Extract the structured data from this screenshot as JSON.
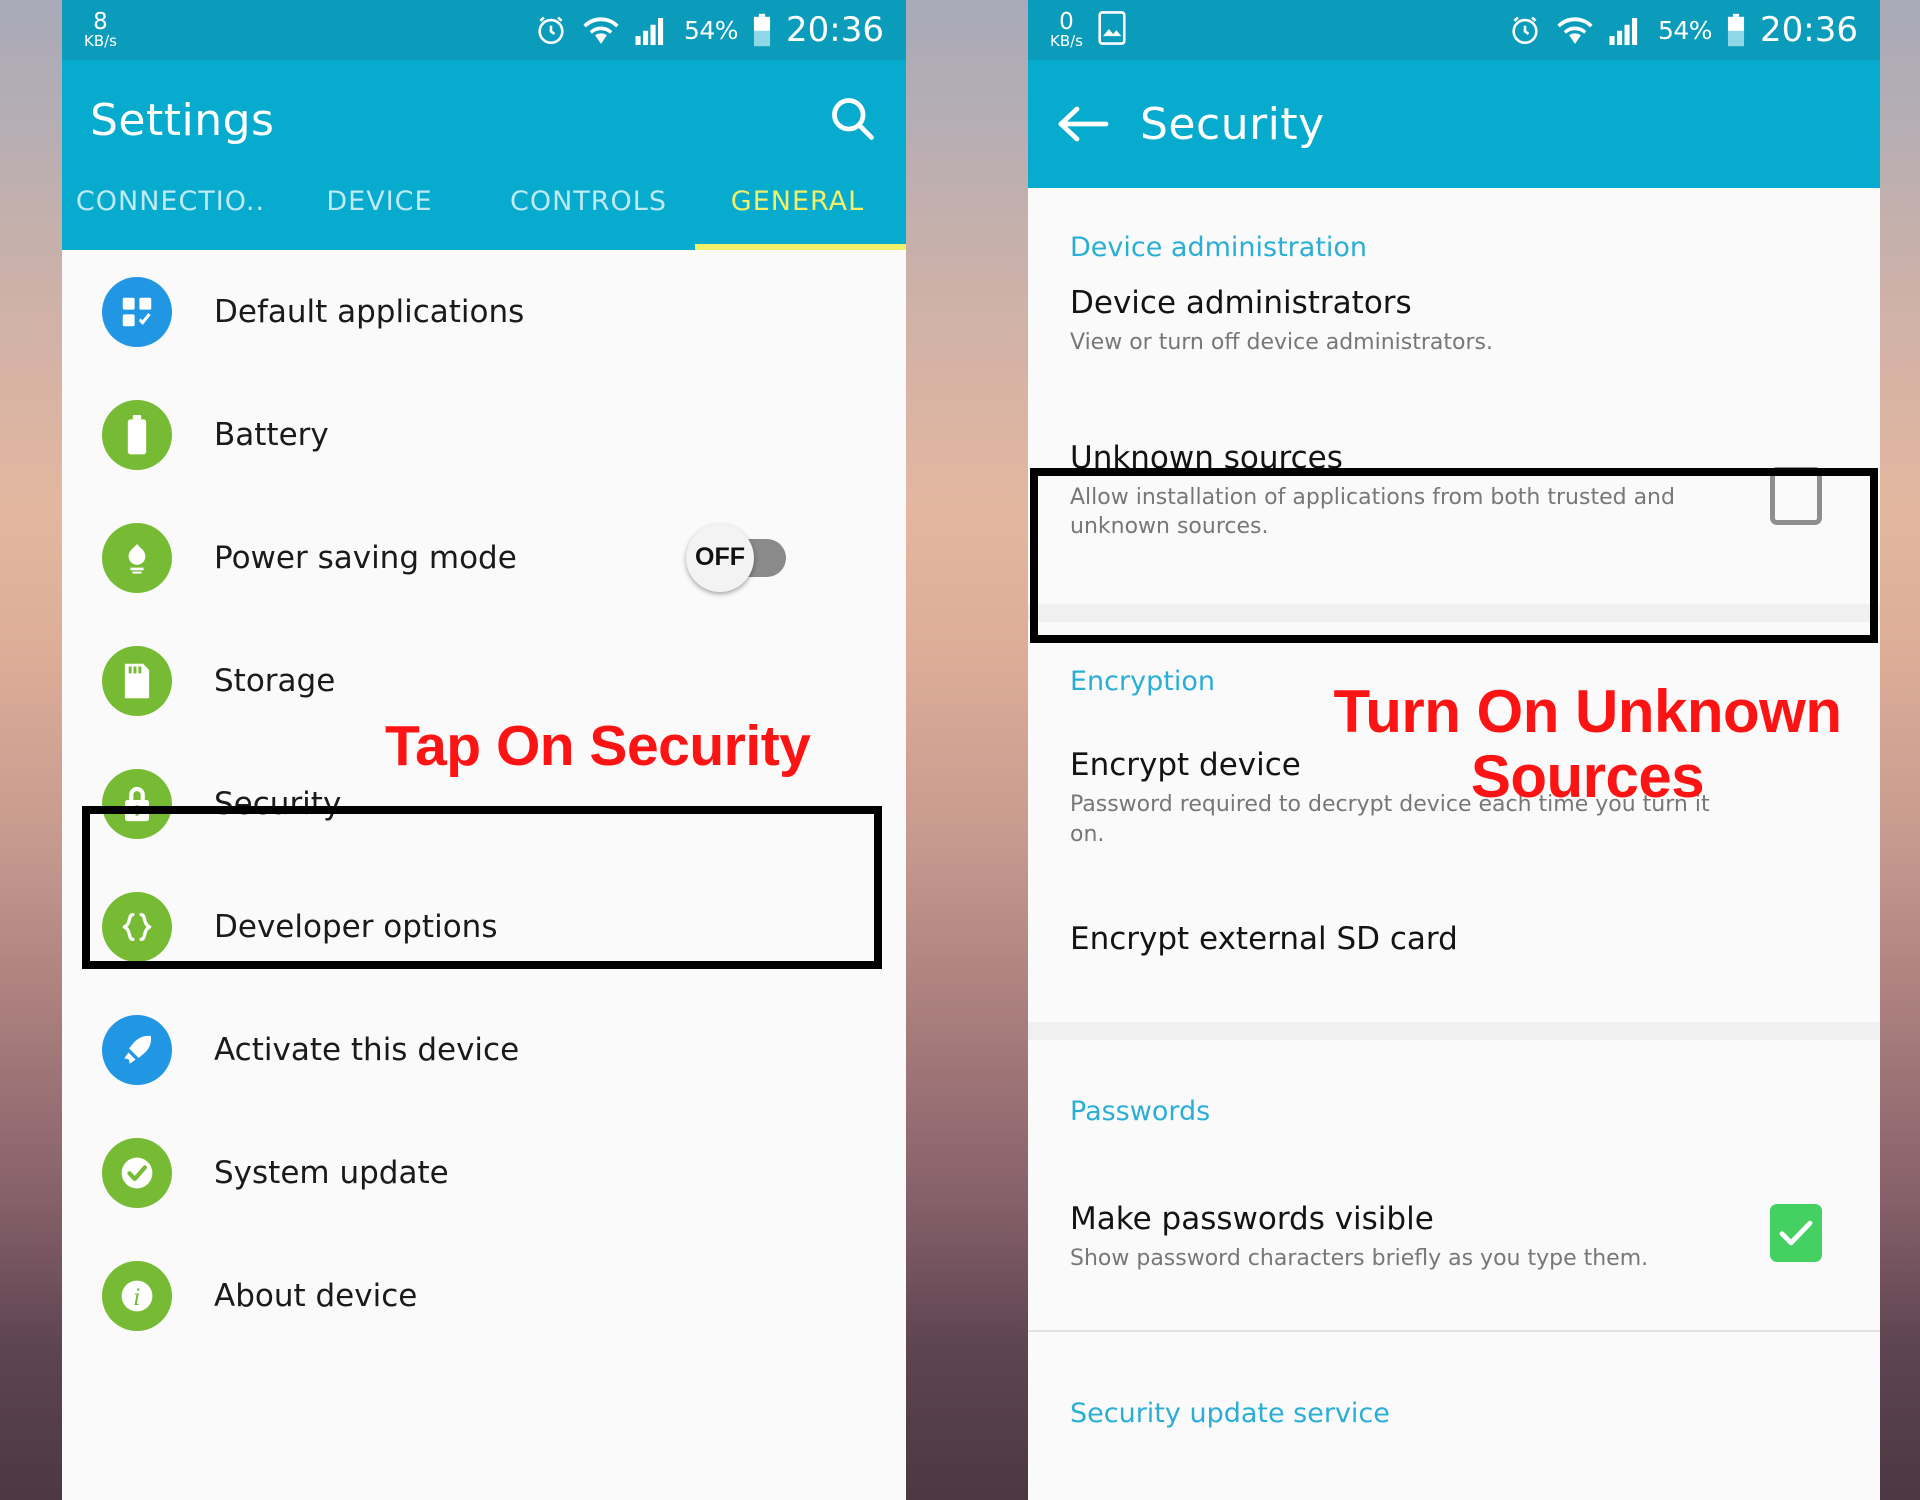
{
  "left_phone": {
    "status_bar": {
      "net_speed_value": "8",
      "net_speed_unit": "KB/s",
      "battery_percent": "54%",
      "clock": "20:36",
      "icons": [
        "alarm-icon",
        "wifi-icon",
        "signal-icon",
        "battery-icon"
      ]
    },
    "app_bar": {
      "title": "Settings",
      "search_icon": "search-icon"
    },
    "tabs": [
      {
        "label": "CONNECTIO..",
        "active": false
      },
      {
        "label": "DEVICE",
        "active": false
      },
      {
        "label": "CONTROLS",
        "active": false
      },
      {
        "label": "GENERAL",
        "active": true
      }
    ],
    "list_items": [
      {
        "label": "Default applications",
        "icon": "default-apps-icon",
        "color": "blue"
      },
      {
        "label": "Battery",
        "icon": "battery-icon",
        "color": "green"
      },
      {
        "label": "Power saving mode",
        "icon": "power-saving-icon",
        "color": "green",
        "toggle": "OFF"
      },
      {
        "label": "Storage",
        "icon": "storage-icon",
        "color": "green"
      },
      {
        "label": "Security",
        "icon": "lock-icon",
        "color": "green",
        "highlighted": true
      },
      {
        "label": "Developer options",
        "icon": "braces-icon",
        "color": "green"
      },
      {
        "label": "Activate this device",
        "icon": "rocket-icon",
        "color": "blue"
      },
      {
        "label": "System update",
        "icon": "check-circle-icon",
        "color": "green"
      },
      {
        "label": "About device",
        "icon": "info-icon",
        "color": "green"
      }
    ],
    "callout": "Tap On Security"
  },
  "right_phone": {
    "status_bar": {
      "net_speed_value": "0",
      "net_speed_unit": "KB/s",
      "screenshot_icon": "screenshot-icon",
      "battery_percent": "54%",
      "clock": "20:36",
      "icons": [
        "alarm-icon",
        "wifi-icon",
        "signal-icon",
        "battery-icon"
      ]
    },
    "app_bar": {
      "title": "Security",
      "back_icon": "back-arrow-icon"
    },
    "sections": [
      {
        "header": "Device administration",
        "items": [
          {
            "title": "Device administrators",
            "subtitle": "View or turn off device administrators.",
            "control": "none"
          },
          {
            "title": "Unknown sources",
            "subtitle": "Allow installation of applications from both trusted and unknown sources.",
            "control": "checkbox",
            "checked": false,
            "highlighted": true
          }
        ]
      },
      {
        "header": "Encryption",
        "items": [
          {
            "title": "Encrypt device",
            "subtitle": "Password required to decrypt device each time you turn it on.",
            "control": "none"
          },
          {
            "title": "Encrypt external SD card",
            "subtitle": "",
            "control": "none"
          }
        ]
      },
      {
        "header": "Passwords",
        "items": [
          {
            "title": "Make passwords visible",
            "subtitle": "Show password characters briefly as you type them.",
            "control": "checkbox",
            "checked": true
          }
        ]
      },
      {
        "header": "Security update service",
        "items": []
      }
    ],
    "callout": "Turn On Unknown Sources"
  },
  "colors": {
    "status_bar": "#0a9cba",
    "app_bar": "#06abce",
    "tab_active": "#f2f06a",
    "section_header": "#2aaed6",
    "callout_red": "#fc1313",
    "icon_green": "#77bb35",
    "icon_blue": "#2196e3",
    "checkbox_on": "#45d062"
  }
}
